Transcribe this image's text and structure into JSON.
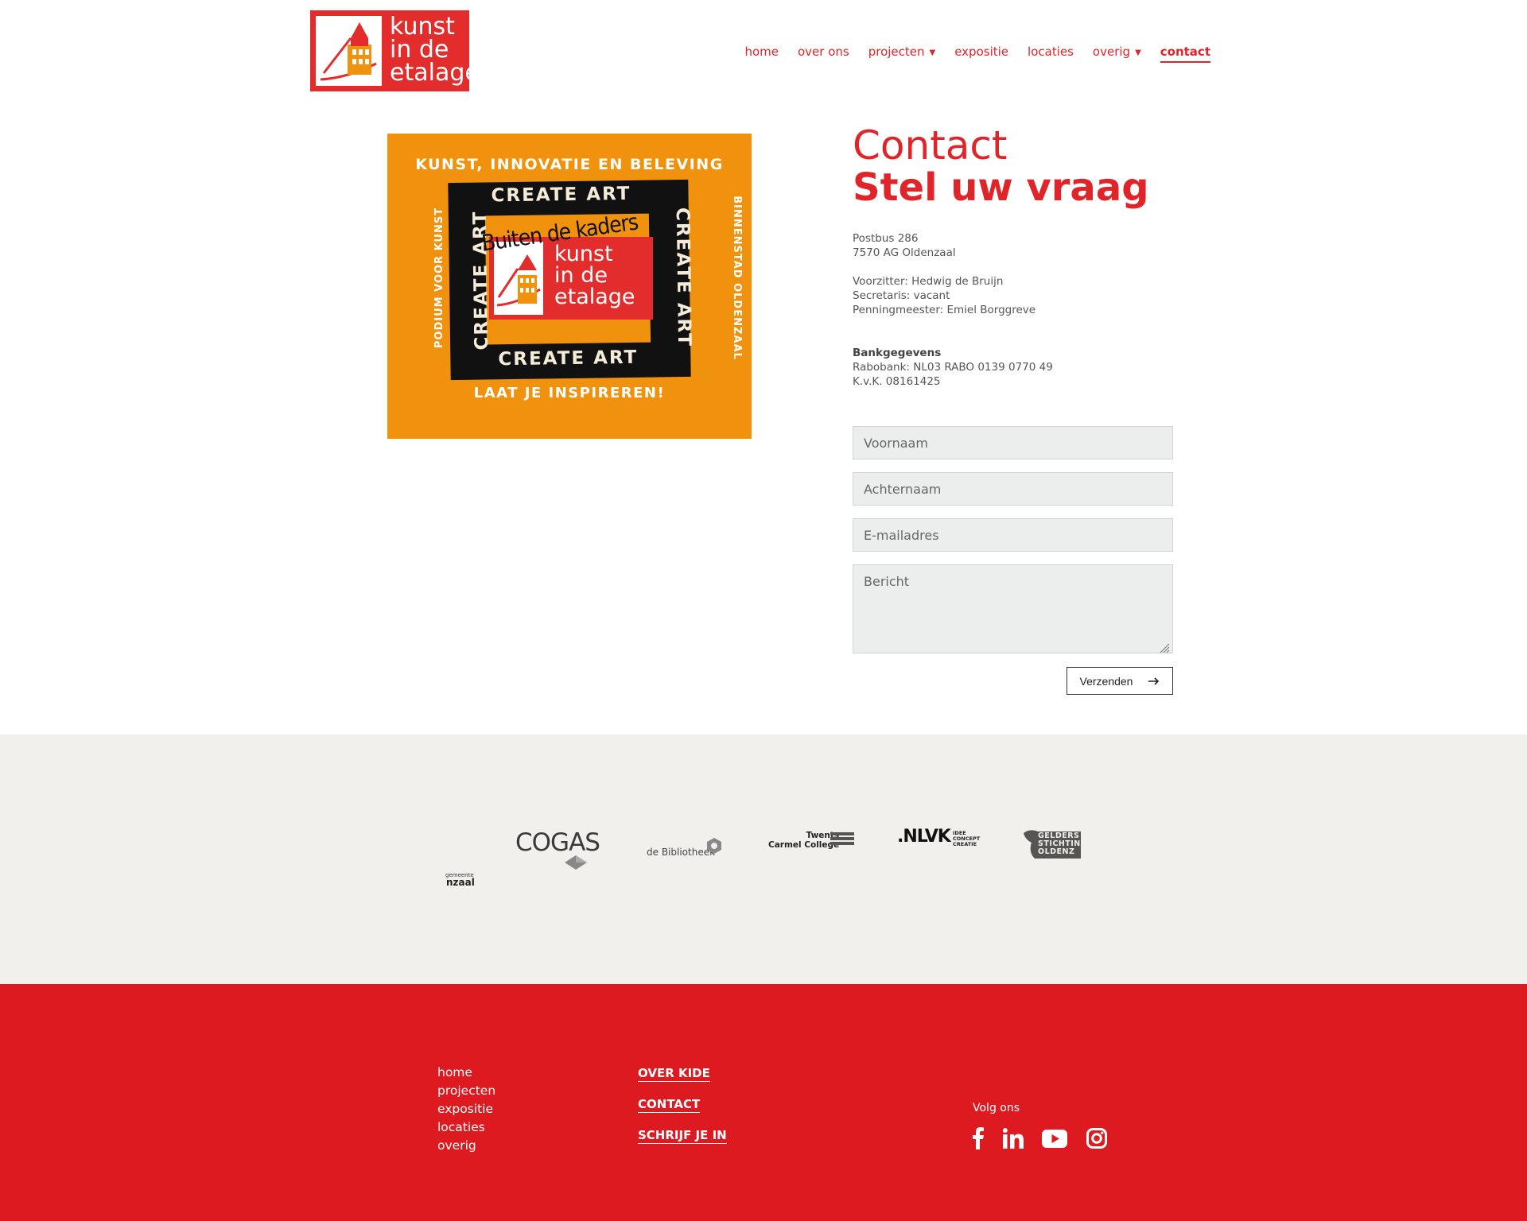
{
  "brand": {
    "logo_line1": "kunst",
    "logo_line2": "in de",
    "logo_line3": "etalage",
    "accent": "#e0252a",
    "poster_orange": "#f0920e",
    "footer_red": "#dd1a1f",
    "partner_bg": "#f2f0ed"
  },
  "nav": {
    "items": [
      {
        "label": "home"
      },
      {
        "label": "over ons"
      },
      {
        "label": "projecten",
        "dropdown": true
      },
      {
        "label": "expositie"
      },
      {
        "label": "locaties"
      },
      {
        "label": "overig",
        "dropdown": true
      },
      {
        "label": "contact",
        "active": true
      }
    ]
  },
  "poster": {
    "top_tagline": "KUNST, INNOVATIE EN BELEVING",
    "bottom_tagline": "LAAT JE INSPIREREN!",
    "left_side": "PODIUM VOOR KUNST",
    "right_side": "BINNENSTAD OLDENZAAL",
    "frame_text": "CREATE ART",
    "headline": "Buiten de kaders",
    "logo_line1": "kunst",
    "logo_line2": "in de",
    "logo_line3": "etalage"
  },
  "contact": {
    "title": "Contact",
    "subtitle": "Stel uw vraag",
    "address_line1": "Postbus 286",
    "address_line2": "7570 AG Oldenzaal",
    "chair": "Voorzitter: Hedwig de Bruijn",
    "secretary": "Secretaris: vacant",
    "treasurer": "Penningmeester: Emiel Borggreve",
    "bank_heading": "Bankgegevens",
    "bank": "Rabobank: NL03 RABO 0139 0770 49",
    "kvk": "K.v.K. 08161425"
  },
  "form": {
    "first_name_placeholder": "Voornaam",
    "last_name_placeholder": "Achternaam",
    "email_placeholder": "E-mailadres",
    "message_placeholder": "Bericht",
    "submit_label": "Verzenden"
  },
  "partners": {
    "cogas": "COGAS",
    "bibliotheek": "de Bibliotheek",
    "twents_1": "Twents",
    "twents_2": "Carmel College",
    "nlvk": ".NLVK",
    "nlvk_sub1": "IDEE",
    "nlvk_sub2": "CONCEPT",
    "nlvk_sub3": "CREATIE",
    "gelders_1": "GELDERS",
    "gelders_2": "STICHTIN",
    "gelders_3": "OLDENZ",
    "gemeente_small": "gemeente",
    "gemeente": "nzaal"
  },
  "footer": {
    "links": [
      "home",
      "projecten",
      "expositie",
      "locaties",
      "overig"
    ],
    "caps": [
      "OVER KIDE",
      "CONTACT",
      "SCHRIJF JE IN"
    ],
    "follow_label": "Volg ons",
    "social_icons": [
      "facebook-icon",
      "linkedin-icon",
      "youtube-icon",
      "instagram-icon"
    ]
  }
}
